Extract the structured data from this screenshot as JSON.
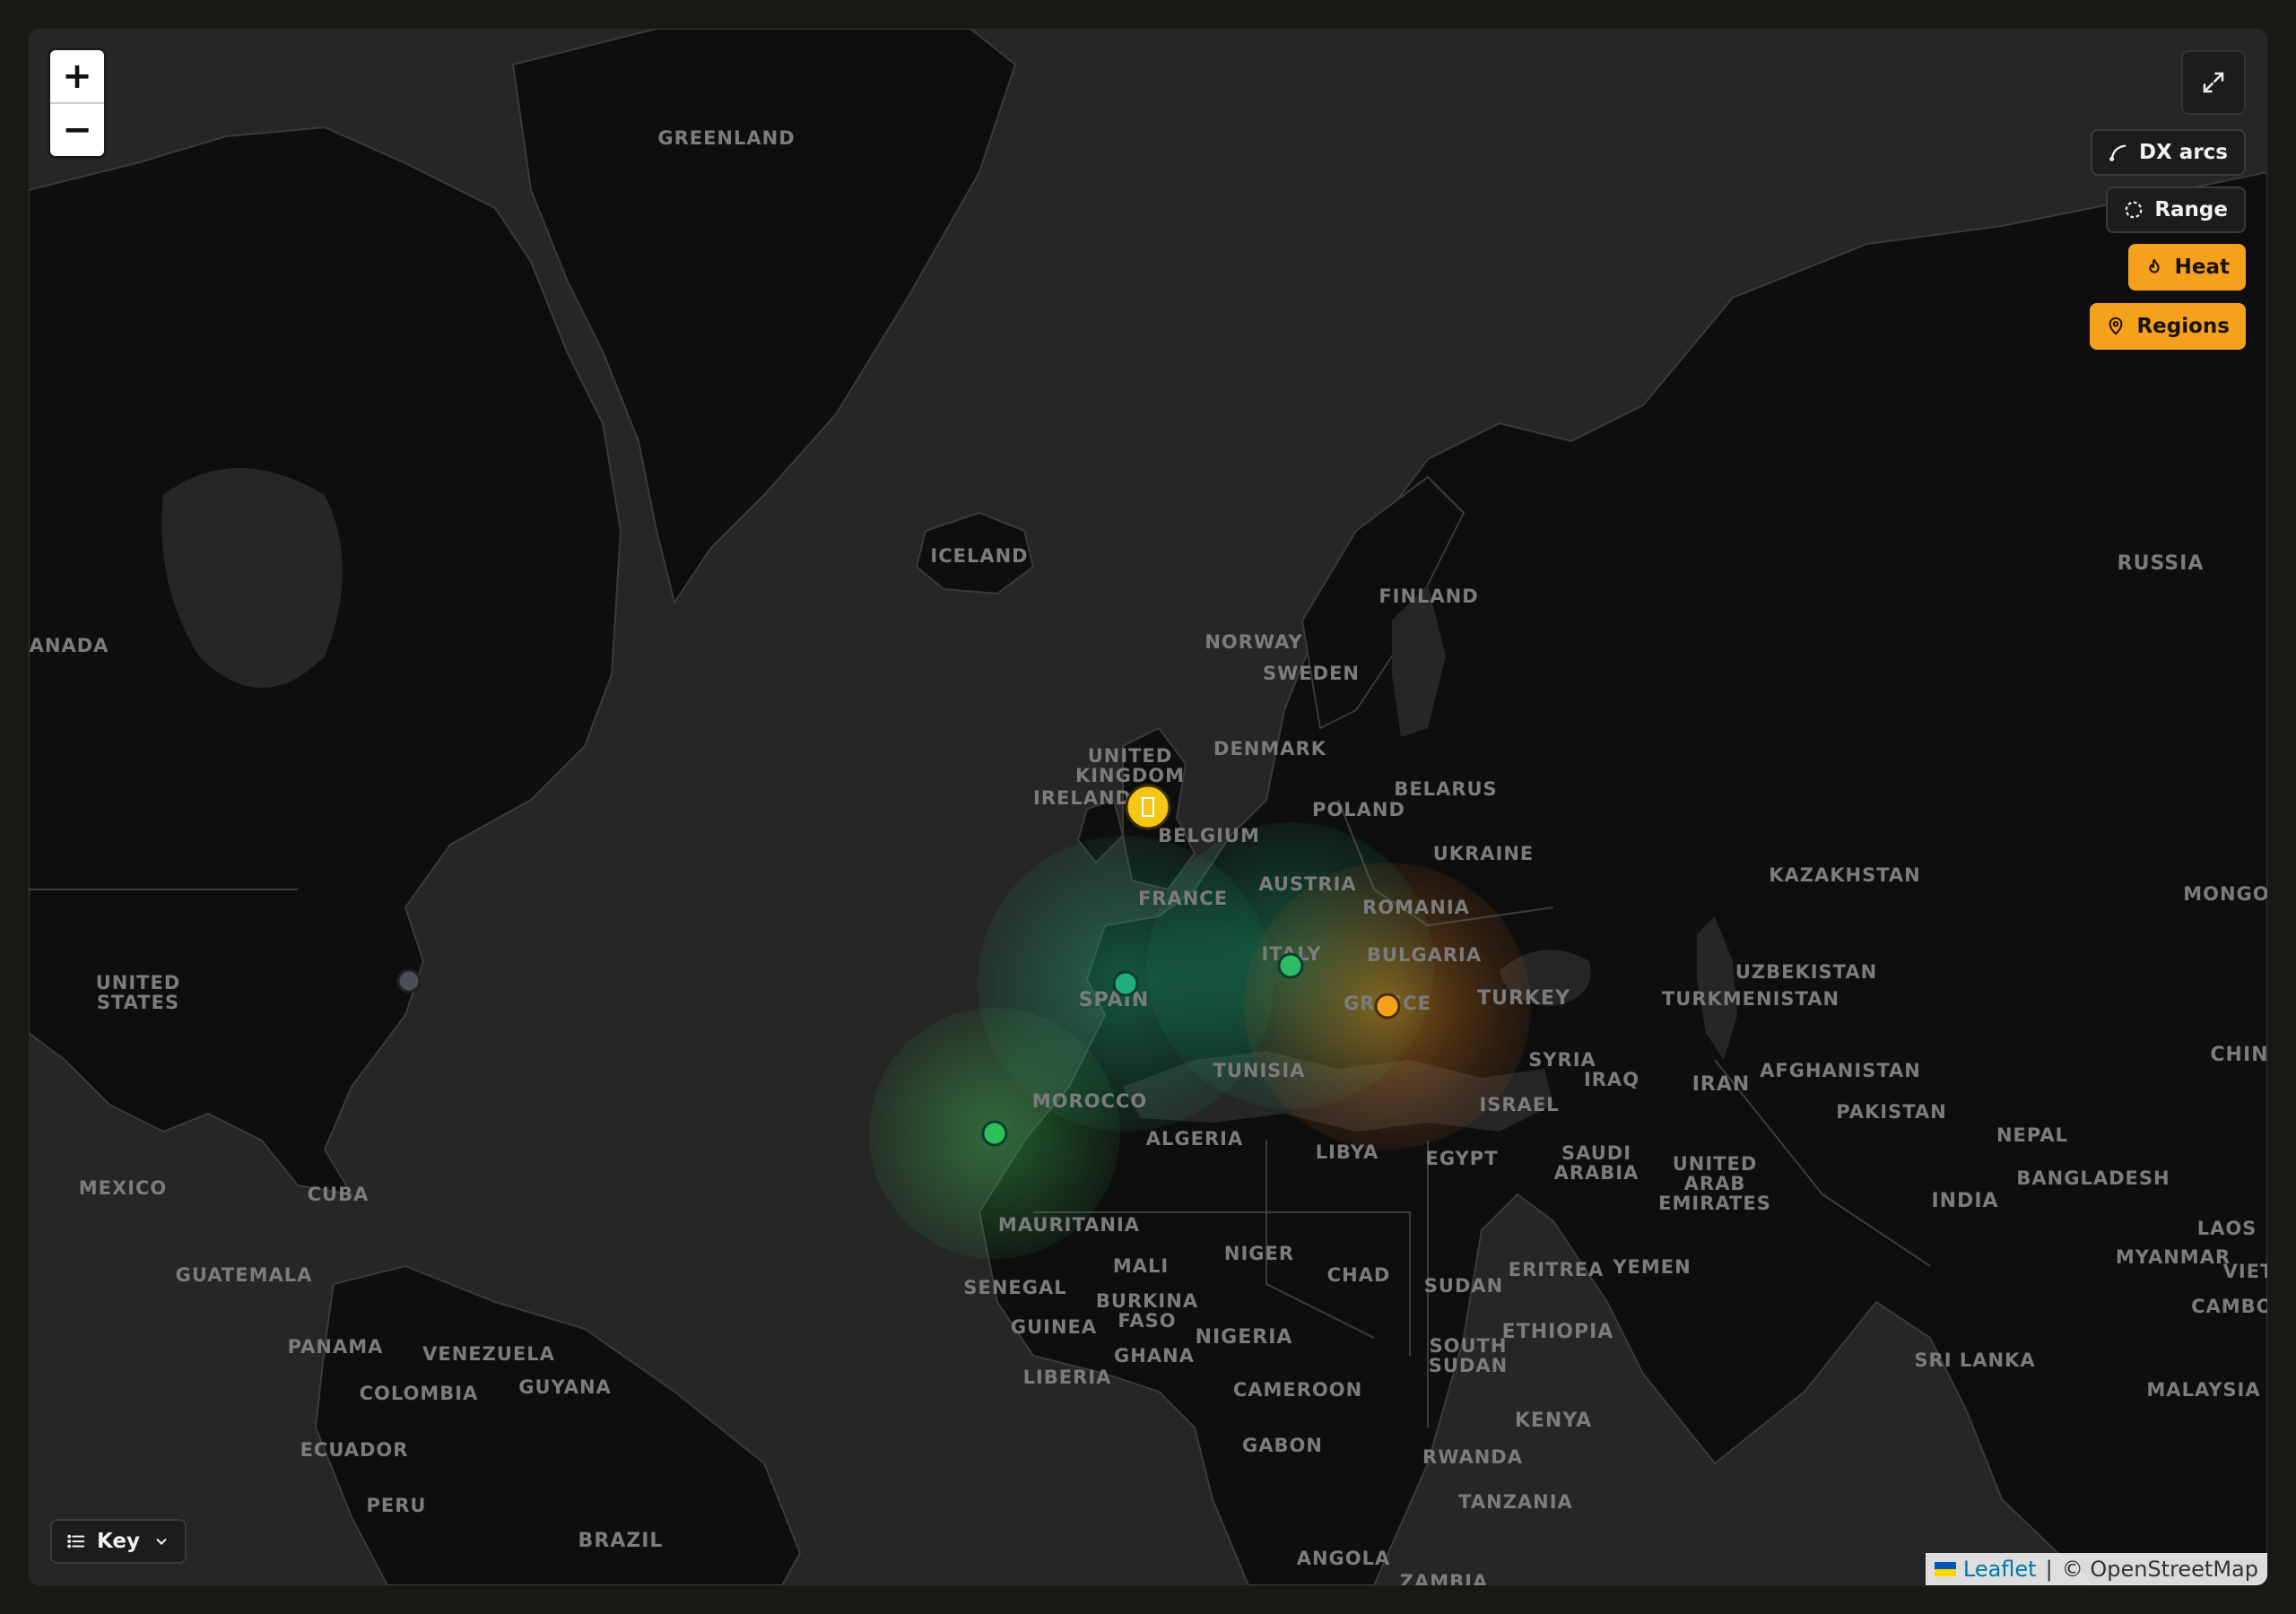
{
  "controls": {
    "zoom_in": "+",
    "zoom_out": "−",
    "fullscreen_icon": "expand-icon",
    "toggles": [
      {
        "label": "DX arcs",
        "icon": "arc-icon",
        "active": false
      },
      {
        "label": "Range",
        "icon": "range-circle-icon",
        "active": false
      },
      {
        "label": "Heat",
        "icon": "flame-icon",
        "active": true
      },
      {
        "label": "Regions",
        "icon": "map-pin-icon",
        "active": true
      }
    ],
    "key_label": "Key"
  },
  "attribution": {
    "leaflet": "Leaflet",
    "separator": "|",
    "osm": "© OpenStreetMap"
  },
  "labels": {
    "greenland": "GREENLAND",
    "iceland": "ICELAND",
    "canada": "ANADA",
    "united_states": "UNITED\nSTATES",
    "mexico": "MEXICO",
    "cuba": "CUBA",
    "guatemala": "GUATEMALA",
    "panama": "PANAMA",
    "venezuela": "VENEZUELA",
    "guyana": "GUYANA",
    "colombia": "COLOMBIA",
    "ecuador": "ECUADOR",
    "peru": "PERU",
    "brazil": "BRAZIL",
    "norway": "NORWAY",
    "sweden": "SWEDEN",
    "finland": "FINLAND",
    "russia": "RUSSIA",
    "united_kingdom": "UNITED\nKINGDOM",
    "ireland": "IRELAND",
    "denmark": "DENMARK",
    "belarus": "BELARUS",
    "poland": "POLAND",
    "belgium": "BELGIUM",
    "ukraine": "UKRAINE",
    "france": "FRANCE",
    "austria": "AUSTRIA",
    "romania": "ROMANIA",
    "italy": "ITALY",
    "bulgaria": "BULGARIA",
    "spain": "SPAIN",
    "greece": "GREECE",
    "turkey": "TURKEY",
    "kazakhstan": "KAZAKHSTAN",
    "mongolia": "MONGOLI",
    "uzbekistan": "UZBEKISTAN",
    "turkmenistan": "TURKMENISTAN",
    "syria": "SYRIA",
    "iraq": "IRAQ",
    "iran": "IRAN",
    "afghanistan": "AFGHANISTAN",
    "china": "CHINA",
    "israel": "ISRAEL",
    "pakistan": "PAKISTAN",
    "nepal": "NEPAL",
    "tunisia": "TUNISIA",
    "morocco": "MOROCCO",
    "algeria": "ALGERIA",
    "libya": "LIBYA",
    "egypt": "EGYPT",
    "saudi_arabia": "SAUDI\nARABIA",
    "uae": "UNITED\nARAB\nEMIRATES",
    "india": "INDIA",
    "bangladesh": "BANGLADESH",
    "laos": "LAOS",
    "myanmar": "MYANMAR",
    "vietnam": "VIET",
    "cambodia": "CAMBOD",
    "mauritania": "MAURITANIA",
    "mali": "MALI",
    "niger": "NIGER",
    "chad": "CHAD",
    "sudan": "SUDAN",
    "eritrea": "ERITREA",
    "yemen": "YEMEN",
    "senegal": "SENEGAL",
    "burkina_faso": "BURKINA\nFASO",
    "guinea": "GUINEA",
    "nigeria": "NIGERIA",
    "ethiopia": "ETHIOPIA",
    "ghana": "GHANA",
    "south_sudan": "SOUTH\nSUDAN",
    "liberia": "LIBERIA",
    "cameroon": "CAMEROON",
    "sri_lanka": "SRI LANKA",
    "malaysia": "MALAYSIA",
    "kenya": "KENYA",
    "gabon": "GABON",
    "rwanda": "RWANDA",
    "tanzania": "TANZANIA",
    "angola": "ANGOLA",
    "zambia": "ZAMBIA"
  },
  "markers": [
    {
      "name": "home-station",
      "color": "#f5c518",
      "glyph": "📻"
    },
    {
      "name": "spot-spain",
      "color": "#1fae7c"
    },
    {
      "name": "spot-italy",
      "color": "#2dbb65"
    },
    {
      "name": "spot-greece",
      "color": "#f6a11c"
    },
    {
      "name": "spot-west-africa",
      "color": "#2fbf5a"
    },
    {
      "name": "spot-us-east",
      "color": "#4b4f5a"
    }
  ]
}
